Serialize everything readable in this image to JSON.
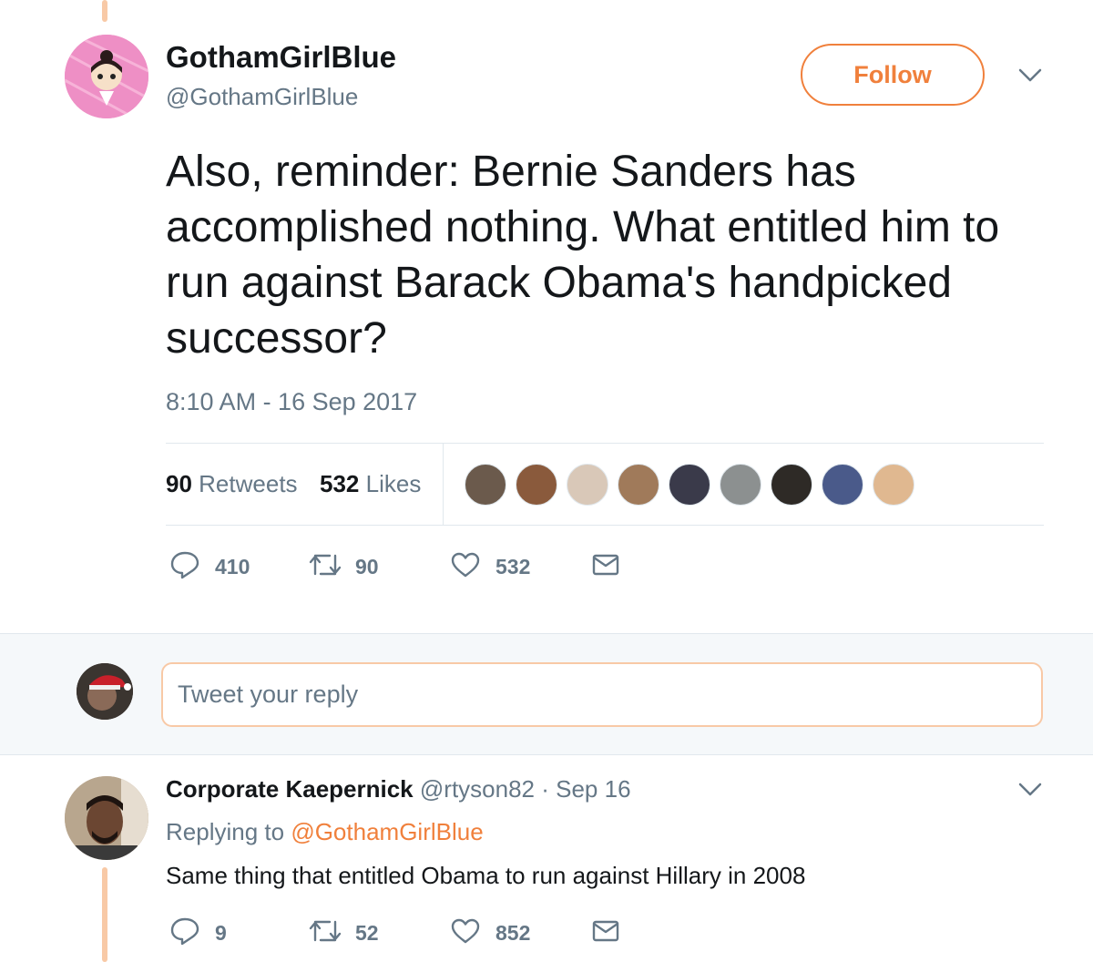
{
  "tweet": {
    "display_name": "GothamGirlBlue",
    "handle": "@GothamGirlBlue",
    "follow_label": "Follow",
    "text": "Also, reminder: Bernie Sanders has accomplished nothing. What entitled him to run against Barack Obama's handpicked successor?",
    "timestamp": "8:10 AM - 16 Sep 2017",
    "stats": {
      "retweets_count": "90",
      "retweets_label": "Retweets",
      "likes_count": "532",
      "likes_label": "Likes"
    },
    "liker_avatars": [
      "#6b5a4c",
      "#8a5a3c",
      "#d9c8b8",
      "#a07a5a",
      "#3a3a4a",
      "#8c9090",
      "#2e2a26",
      "#4a5a8a",
      "#e0b890"
    ],
    "actions": {
      "replies": "410",
      "retweets": "90",
      "likes": "532"
    }
  },
  "reply_box": {
    "placeholder": "Tweet your reply"
  },
  "reply": {
    "display_name": "Corporate Kaepernick",
    "handle": "@rtyson82",
    "date": "· Sep 16",
    "replying_prefix": "Replying to",
    "replying_to": "@GothamGirlBlue",
    "text": "Same thing that entitled Obama to run against Hillary in 2008",
    "actions": {
      "replies": "9",
      "retweets": "52",
      "likes": "852"
    }
  },
  "colors": {
    "accent": "#f0803c",
    "thread_line": "#f8c9a6",
    "secondary_text": "#657786",
    "primary_text": "#14171a",
    "border": "#e1e8ed"
  },
  "icons": [
    "chevron-down-icon",
    "reply-icon",
    "retweet-icon",
    "like-icon",
    "message-icon"
  ]
}
